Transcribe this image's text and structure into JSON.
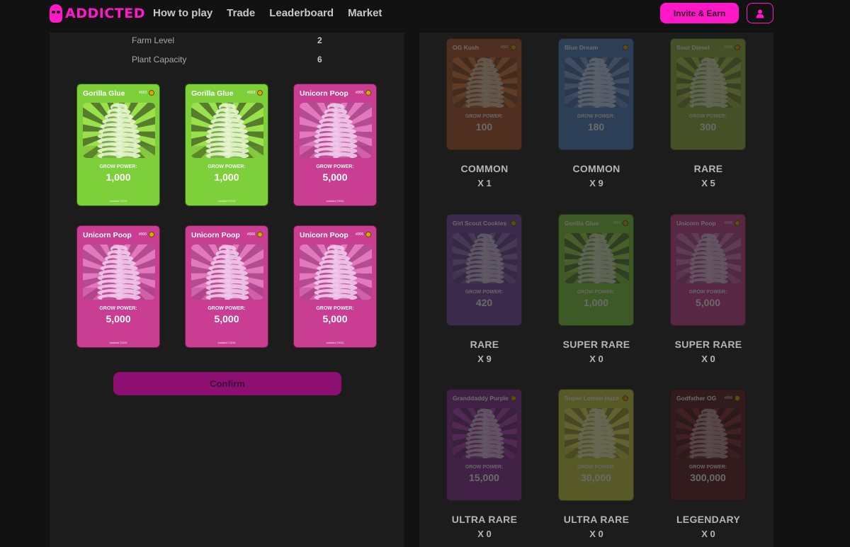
{
  "header": {
    "brand": "ADDICTED",
    "nav": [
      "How to play",
      "Trade",
      "Leaderboard",
      "Market"
    ],
    "invite_label": "Invite & Earn",
    "brand_color": "#ff19c8"
  },
  "farm": {
    "stats": [
      {
        "label": "Farm Level",
        "value": "2"
      },
      {
        "label": "Plant Capacity",
        "value": "6"
      }
    ],
    "selected_cards": [
      {
        "name": "Gorilla Glue",
        "num": "#003",
        "gp_label": "GROW POWER:",
        "gp": "1,000",
        "theme": "green",
        "footer": "Addicted ©2023"
      },
      {
        "name": "Gorilla Glue",
        "num": "#003",
        "gp_label": "GROW POWER:",
        "gp": "1,000",
        "theme": "green",
        "footer": "Addicted ©2023"
      },
      {
        "name": "Unicorn Poop",
        "num": "#006",
        "gp_label": "GROW POWER:",
        "gp": "5,000",
        "theme": "pink",
        "footer": "Addicted ©2023"
      },
      {
        "name": "Unicorn Poop",
        "num": "#006",
        "gp_label": "GROW POWER:",
        "gp": "5,000",
        "theme": "pink",
        "footer": "Addicted ©2023"
      },
      {
        "name": "Unicorn Poop",
        "num": "#006",
        "gp_label": "GROW POWER:",
        "gp": "5,000",
        "theme": "pink",
        "footer": "Addicted ©2023"
      },
      {
        "name": "Unicorn Poop",
        "num": "#006",
        "gp_label": "GROW POWER:",
        "gp": "5,000",
        "theme": "pink",
        "footer": "Addicted ©2023"
      }
    ],
    "confirm_label": "Confirm"
  },
  "inventory": [
    {
      "name": "OG Kush",
      "num": "#001",
      "gp_label": "GROW POWER:",
      "gp": "100",
      "rarity": "COMMON",
      "count": "X 1",
      "theme": "og"
    },
    {
      "name": "Blue Dream",
      "num": "",
      "gp_label": "GROW POWER:",
      "gp": "180",
      "rarity": "COMMON",
      "count": "X 9",
      "theme": "blue"
    },
    {
      "name": "Sour Diesel",
      "num": "#002",
      "gp_label": "GROW POWER:",
      "gp": "300",
      "rarity": "RARE",
      "count": "X 5",
      "theme": "olive"
    },
    {
      "name": "Girl Scout Cookies",
      "num": "",
      "gp_label": "GROW POWER:",
      "gp": "420",
      "rarity": "RARE",
      "count": "X 9",
      "theme": "violet"
    },
    {
      "name": "Gorilla Glue",
      "num": "#003",
      "gp_label": "GROW POWER:",
      "gp": "1,000",
      "rarity": "SUPER RARE",
      "count": "X 0",
      "theme": "green"
    },
    {
      "name": "Unicorn Poop",
      "num": "#006",
      "gp_label": "GROW POWER:",
      "gp": "5,000",
      "rarity": "SUPER RARE",
      "count": "X 0",
      "theme": "pink"
    },
    {
      "name": "Granddaddy Purple",
      "num": "",
      "gp_label": "GROW POWER:",
      "gp": "15,000",
      "rarity": "ULTRA RARE",
      "count": "X 0",
      "theme": "purple"
    },
    {
      "name": "Super Lemon Haze",
      "num": "",
      "gp_label": "GROW POWER:",
      "gp": "30,000",
      "rarity": "ULTRA RARE",
      "count": "X 0",
      "theme": "yellow"
    },
    {
      "name": "Godfather OG",
      "num": "#009",
      "gp_label": "GROW POWER:",
      "gp": "300,000",
      "rarity": "LEGENDARY",
      "count": "X 0",
      "theme": "black"
    }
  ]
}
